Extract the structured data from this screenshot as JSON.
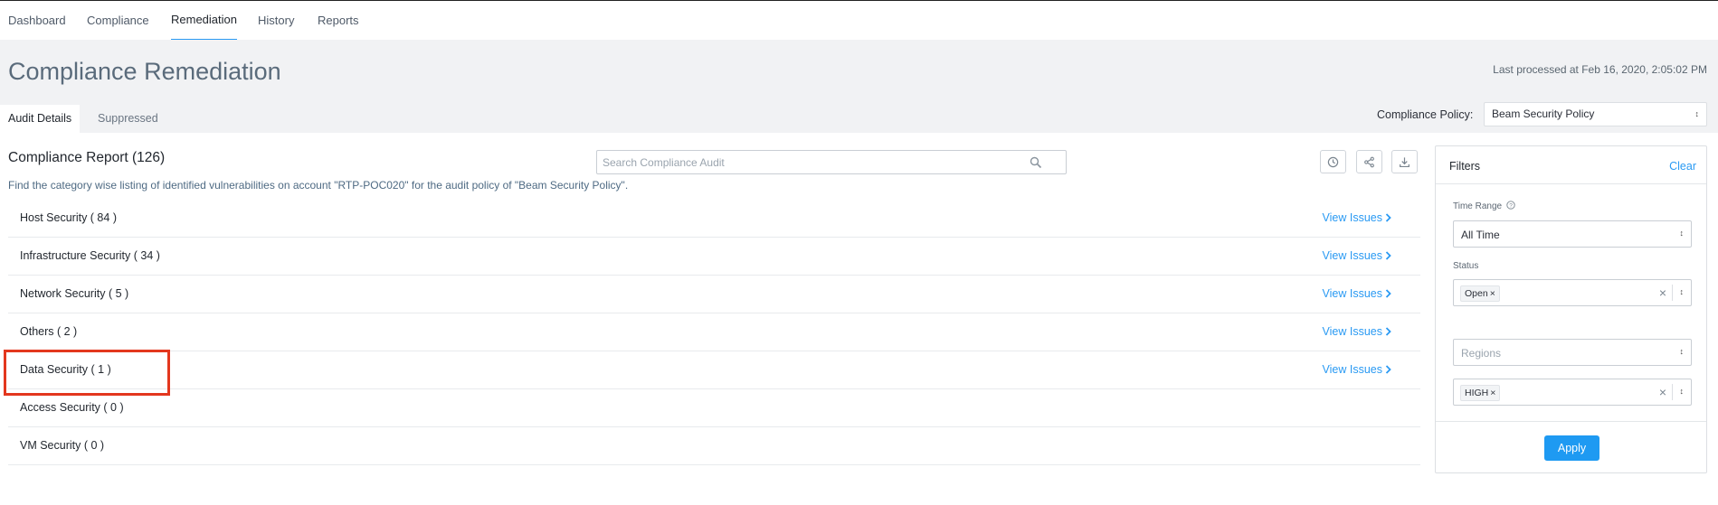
{
  "nav": {
    "tabs": [
      "Dashboard",
      "Compliance",
      "Remediation",
      "History",
      "Reports"
    ],
    "active": "Remediation"
  },
  "header": {
    "title": "Compliance Remediation",
    "last_processed": "Last processed at Feb 16, 2020, 2:05:02 PM",
    "subtabs": [
      "Audit Details",
      "Suppressed"
    ],
    "policy_label": "Compliance Policy:",
    "policy_value": "Beam Security Policy"
  },
  "report": {
    "title": "Compliance Report (126)",
    "description": "Find the category wise listing of identified vulnerabilities on account \"RTP-POC020\" for the audit policy of \"Beam Security Policy\".",
    "search_placeholder": "Search Compliance Audit",
    "view_issues_label": "View Issues",
    "categories": [
      {
        "label": "Host Security ( 84 )",
        "view": "View Issues"
      },
      {
        "label": "Infrastructure Security ( 34 )",
        "view": "View Issues"
      },
      {
        "label": "Network Security ( 5 )",
        "view": "View Issues"
      },
      {
        "label": "Others ( 2 )",
        "view": "View Issues"
      },
      {
        "label": "Data Security ( 1 )",
        "view": "View Issues"
      },
      {
        "label": "Access Security ( 0 )",
        "view": ""
      },
      {
        "label": "VM Security ( 0 )",
        "view": ""
      }
    ]
  },
  "filters": {
    "title": "Filters",
    "clear": "Clear",
    "time_range_label": "Time Range",
    "time_range_value": "All Time",
    "status_label": "Status",
    "status_chip": "Open",
    "regions_placeholder": "Regions",
    "severity_chip": "HIGH",
    "apply": "Apply"
  },
  "colors": {
    "accent": "#2a9af3",
    "highlight": "#e3371e",
    "header_bg": "#f1f2f4"
  }
}
